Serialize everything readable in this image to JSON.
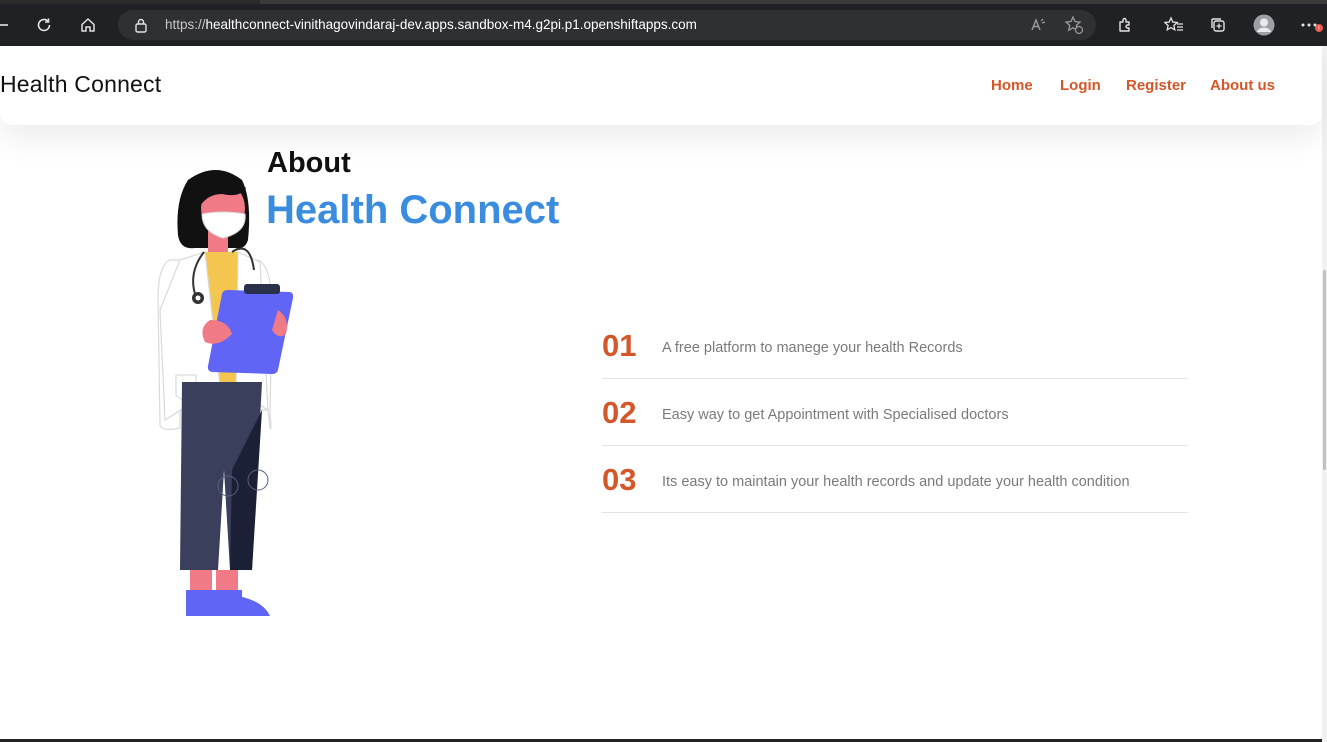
{
  "browser": {
    "url_prefix": "https://",
    "url_domain": "healthconnect-vinithagovindaraj-dev.apps.sandbox-m4.g2pi.p1.openshiftapps.com",
    "notification_badge": "!"
  },
  "header": {
    "brand": "Health Connect",
    "nav": [
      "Home",
      "Login",
      "Register",
      "About us"
    ]
  },
  "about": {
    "label": "About",
    "title": "Health Connect"
  },
  "features": [
    {
      "num": "01",
      "text": "A free platform to manege your health Records"
    },
    {
      "num": "02",
      "text": "Easy way to get Appointment with Specialised doctors"
    },
    {
      "num": "03",
      "text": "Its easy to maintain your health records and update your health condition"
    }
  ],
  "colors": {
    "accent": "#d4572a",
    "title_blue": "#3a8dde"
  }
}
